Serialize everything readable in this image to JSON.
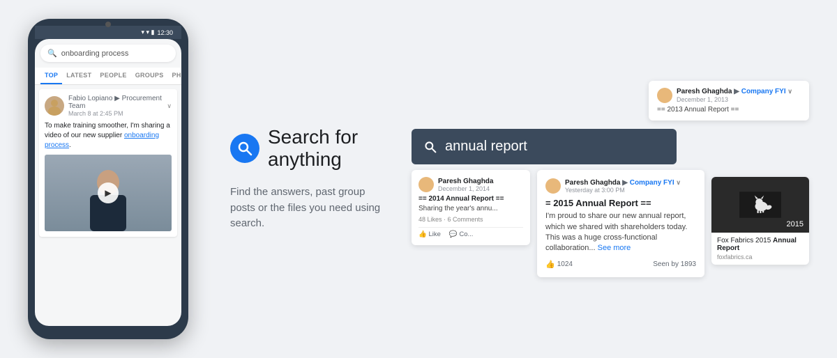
{
  "phone": {
    "status_time": "12:30",
    "search_placeholder": "onboarding process",
    "tabs": [
      "TOP",
      "LATEST",
      "PEOPLE",
      "GROUPS",
      "PH..."
    ],
    "active_tab": "TOP",
    "post": {
      "author": "Fabio Lopiano",
      "arrow": "▶",
      "group": "Procurement Team",
      "time": "March 8 at 2:45 PM",
      "text": "To make training smoother, I'm sharing a video of our new supplier ",
      "link_text": "onboarding process",
      "text_end": "."
    }
  },
  "feature": {
    "title": "Search for anything",
    "description": "Find the answers, past group posts\nor the files you need using search."
  },
  "mini_card": {
    "author": "Paresh Ghaghdа",
    "separator": "▶",
    "group": "Company FYI",
    "time": "December 1, 2013",
    "text": "== 2013 Annual Report =="
  },
  "search_box": {
    "query": "annual report"
  },
  "result_small": {
    "author": "Paresh Ghaghdа",
    "time": "December 1, 2014",
    "title": "== 2014 Annual Report ==",
    "text": "Sharing the year's annu...",
    "likes": "48 Likes",
    "comments": "6 Comments",
    "like_label": "Like",
    "comment_label": "Co..."
  },
  "result_large": {
    "author": "Paresh Ghaghdа",
    "separator": "▶",
    "group": "Company FYI",
    "chevron": "∨",
    "time": "Yesterday at 3:00 PM",
    "post_title": "= 2015 Annual Report ==",
    "text": "I'm proud to share our new annual report, which we shared with shareholders today. This was a huge cross-functional collaboration...",
    "see_more": "See more",
    "likes_count": "1024",
    "seen_by_label": "Seen by",
    "seen_count": "1893"
  },
  "file_card": {
    "title_before": "Fox Fabrics 2015 ",
    "title_bold": "Annual Report",
    "url": "foxfabrics.ca",
    "year": "2015"
  },
  "colors": {
    "blue": "#1877f2",
    "dark_nav": "#3b4a5c",
    "bg": "#f0f2f5"
  }
}
